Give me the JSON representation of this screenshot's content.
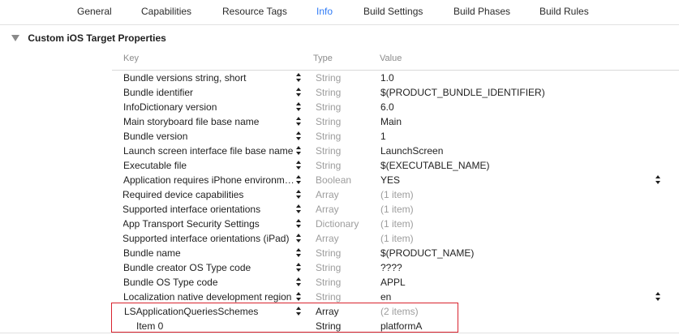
{
  "tabs": [
    "General",
    "Capabilities",
    "Resource Tags",
    "Info",
    "Build Settings",
    "Build Phases",
    "Build Rules"
  ],
  "active_tab": "Info",
  "section": {
    "title": "Custom iOS Target Properties"
  },
  "columns": {
    "key": "Key",
    "type": "Type",
    "value": "Value"
  },
  "rows": [
    {
      "key": "Bundle versions string, short",
      "type": "String",
      "value": "1.0"
    },
    {
      "key": "Bundle identifier",
      "type": "String",
      "value": "$(PRODUCT_BUNDLE_IDENTIFIER)"
    },
    {
      "key": "InfoDictionary version",
      "type": "String",
      "value": "6.0"
    },
    {
      "key": "Main storyboard file base name",
      "type": "String",
      "value": "Main"
    },
    {
      "key": "Bundle version",
      "type": "String",
      "value": "1"
    },
    {
      "key": "Launch screen interface file base name",
      "type": "String",
      "value": "LaunchScreen"
    },
    {
      "key": "Executable file",
      "type": "String",
      "value": "$(EXECUTABLE_NAME)"
    },
    {
      "key": "Application requires iPhone environm…",
      "type": "Boolean",
      "value": "YES"
    },
    {
      "key": "Required device capabilities",
      "type": "Array",
      "value": "(1 item)"
    },
    {
      "key": "Supported interface orientations",
      "type": "Array",
      "value": "(1 item)"
    },
    {
      "key": "App Transport Security Settings",
      "type": "Dictionary",
      "value": "(1 item)"
    },
    {
      "key": "Supported interface orientations (iPad)",
      "type": "Array",
      "value": "(1 item)"
    },
    {
      "key": "Bundle name",
      "type": "String",
      "value": "$(PRODUCT_NAME)"
    },
    {
      "key": "Bundle creator OS Type code",
      "type": "String",
      "value": "????"
    },
    {
      "key": "Bundle OS Type code",
      "type": "String",
      "value": "APPL"
    },
    {
      "key": "Localization native development region",
      "type": "String",
      "value": "en"
    },
    {
      "key": "LSApplicationQueriesSchemes",
      "type": "Array",
      "value": "(2 items)"
    },
    {
      "key": "Item 0",
      "type": "String",
      "value": "platformA"
    }
  ],
  "colors": {
    "accent": "#2f7bf6",
    "highlight_border": "#d9232e",
    "muted_text": "#9d9d9d"
  },
  "icons": [
    "disclosure-open-icon",
    "disclosure-closed-icon",
    "stepper-icon"
  ]
}
